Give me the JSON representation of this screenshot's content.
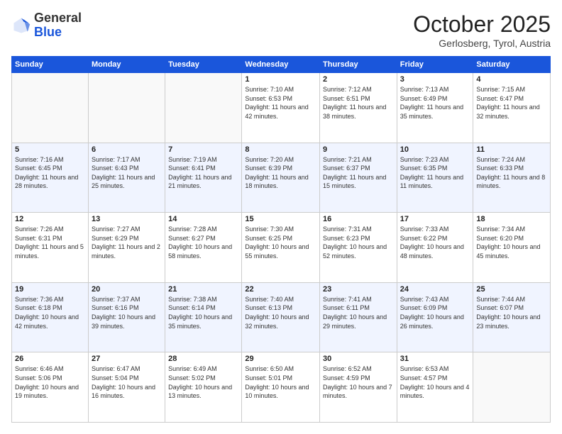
{
  "header": {
    "logo_general": "General",
    "logo_blue": "Blue",
    "month_title": "October 2025",
    "location": "Gerlosberg, Tyrol, Austria"
  },
  "days_of_week": [
    "Sunday",
    "Monday",
    "Tuesday",
    "Wednesday",
    "Thursday",
    "Friday",
    "Saturday"
  ],
  "weeks": [
    [
      {
        "day": "",
        "sunrise": "",
        "sunset": "",
        "daylight": ""
      },
      {
        "day": "",
        "sunrise": "",
        "sunset": "",
        "daylight": ""
      },
      {
        "day": "",
        "sunrise": "",
        "sunset": "",
        "daylight": ""
      },
      {
        "day": "1",
        "sunrise": "Sunrise: 7:10 AM",
        "sunset": "Sunset: 6:53 PM",
        "daylight": "Daylight: 11 hours and 42 minutes."
      },
      {
        "day": "2",
        "sunrise": "Sunrise: 7:12 AM",
        "sunset": "Sunset: 6:51 PM",
        "daylight": "Daylight: 11 hours and 38 minutes."
      },
      {
        "day": "3",
        "sunrise": "Sunrise: 7:13 AM",
        "sunset": "Sunset: 6:49 PM",
        "daylight": "Daylight: 11 hours and 35 minutes."
      },
      {
        "day": "4",
        "sunrise": "Sunrise: 7:15 AM",
        "sunset": "Sunset: 6:47 PM",
        "daylight": "Daylight: 11 hours and 32 minutes."
      }
    ],
    [
      {
        "day": "5",
        "sunrise": "Sunrise: 7:16 AM",
        "sunset": "Sunset: 6:45 PM",
        "daylight": "Daylight: 11 hours and 28 minutes."
      },
      {
        "day": "6",
        "sunrise": "Sunrise: 7:17 AM",
        "sunset": "Sunset: 6:43 PM",
        "daylight": "Daylight: 11 hours and 25 minutes."
      },
      {
        "day": "7",
        "sunrise": "Sunrise: 7:19 AM",
        "sunset": "Sunset: 6:41 PM",
        "daylight": "Daylight: 11 hours and 21 minutes."
      },
      {
        "day": "8",
        "sunrise": "Sunrise: 7:20 AM",
        "sunset": "Sunset: 6:39 PM",
        "daylight": "Daylight: 11 hours and 18 minutes."
      },
      {
        "day": "9",
        "sunrise": "Sunrise: 7:21 AM",
        "sunset": "Sunset: 6:37 PM",
        "daylight": "Daylight: 11 hours and 15 minutes."
      },
      {
        "day": "10",
        "sunrise": "Sunrise: 7:23 AM",
        "sunset": "Sunset: 6:35 PM",
        "daylight": "Daylight: 11 hours and 11 minutes."
      },
      {
        "day": "11",
        "sunrise": "Sunrise: 7:24 AM",
        "sunset": "Sunset: 6:33 PM",
        "daylight": "Daylight: 11 hours and 8 minutes."
      }
    ],
    [
      {
        "day": "12",
        "sunrise": "Sunrise: 7:26 AM",
        "sunset": "Sunset: 6:31 PM",
        "daylight": "Daylight: 11 hours and 5 minutes."
      },
      {
        "day": "13",
        "sunrise": "Sunrise: 7:27 AM",
        "sunset": "Sunset: 6:29 PM",
        "daylight": "Daylight: 11 hours and 2 minutes."
      },
      {
        "day": "14",
        "sunrise": "Sunrise: 7:28 AM",
        "sunset": "Sunset: 6:27 PM",
        "daylight": "Daylight: 10 hours and 58 minutes."
      },
      {
        "day": "15",
        "sunrise": "Sunrise: 7:30 AM",
        "sunset": "Sunset: 6:25 PM",
        "daylight": "Daylight: 10 hours and 55 minutes."
      },
      {
        "day": "16",
        "sunrise": "Sunrise: 7:31 AM",
        "sunset": "Sunset: 6:23 PM",
        "daylight": "Daylight: 10 hours and 52 minutes."
      },
      {
        "day": "17",
        "sunrise": "Sunrise: 7:33 AM",
        "sunset": "Sunset: 6:22 PM",
        "daylight": "Daylight: 10 hours and 48 minutes."
      },
      {
        "day": "18",
        "sunrise": "Sunrise: 7:34 AM",
        "sunset": "Sunset: 6:20 PM",
        "daylight": "Daylight: 10 hours and 45 minutes."
      }
    ],
    [
      {
        "day": "19",
        "sunrise": "Sunrise: 7:36 AM",
        "sunset": "Sunset: 6:18 PM",
        "daylight": "Daylight: 10 hours and 42 minutes."
      },
      {
        "day": "20",
        "sunrise": "Sunrise: 7:37 AM",
        "sunset": "Sunset: 6:16 PM",
        "daylight": "Daylight: 10 hours and 39 minutes."
      },
      {
        "day": "21",
        "sunrise": "Sunrise: 7:38 AM",
        "sunset": "Sunset: 6:14 PM",
        "daylight": "Daylight: 10 hours and 35 minutes."
      },
      {
        "day": "22",
        "sunrise": "Sunrise: 7:40 AM",
        "sunset": "Sunset: 6:13 PM",
        "daylight": "Daylight: 10 hours and 32 minutes."
      },
      {
        "day": "23",
        "sunrise": "Sunrise: 7:41 AM",
        "sunset": "Sunset: 6:11 PM",
        "daylight": "Daylight: 10 hours and 29 minutes."
      },
      {
        "day": "24",
        "sunrise": "Sunrise: 7:43 AM",
        "sunset": "Sunset: 6:09 PM",
        "daylight": "Daylight: 10 hours and 26 minutes."
      },
      {
        "day": "25",
        "sunrise": "Sunrise: 7:44 AM",
        "sunset": "Sunset: 6:07 PM",
        "daylight": "Daylight: 10 hours and 23 minutes."
      }
    ],
    [
      {
        "day": "26",
        "sunrise": "Sunrise: 6:46 AM",
        "sunset": "Sunset: 5:06 PM",
        "daylight": "Daylight: 10 hours and 19 minutes."
      },
      {
        "day": "27",
        "sunrise": "Sunrise: 6:47 AM",
        "sunset": "Sunset: 5:04 PM",
        "daylight": "Daylight: 10 hours and 16 minutes."
      },
      {
        "day": "28",
        "sunrise": "Sunrise: 6:49 AM",
        "sunset": "Sunset: 5:02 PM",
        "daylight": "Daylight: 10 hours and 13 minutes."
      },
      {
        "day": "29",
        "sunrise": "Sunrise: 6:50 AM",
        "sunset": "Sunset: 5:01 PM",
        "daylight": "Daylight: 10 hours and 10 minutes."
      },
      {
        "day": "30",
        "sunrise": "Sunrise: 6:52 AM",
        "sunset": "Sunset: 4:59 PM",
        "daylight": "Daylight: 10 hours and 7 minutes."
      },
      {
        "day": "31",
        "sunrise": "Sunrise: 6:53 AM",
        "sunset": "Sunset: 4:57 PM",
        "daylight": "Daylight: 10 hours and 4 minutes."
      },
      {
        "day": "",
        "sunrise": "",
        "sunset": "",
        "daylight": ""
      }
    ]
  ]
}
